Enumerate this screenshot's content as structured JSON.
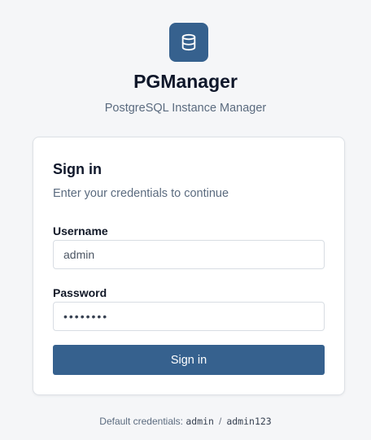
{
  "app": {
    "title": "PGManager",
    "subtitle": "PostgreSQL Instance Manager",
    "logo_icon": "database-icon",
    "accent_color": "#36618e"
  },
  "login": {
    "title": "Sign in",
    "description": "Enter your credentials to continue",
    "username_label": "Username",
    "username_value": "admin",
    "password_label": "Password",
    "password_value": "admin123",
    "submit_label": "Sign in"
  },
  "footer": {
    "hint_prefix": "Default credentials:",
    "default_username": "admin",
    "separator": "/",
    "default_password": "admin123"
  }
}
